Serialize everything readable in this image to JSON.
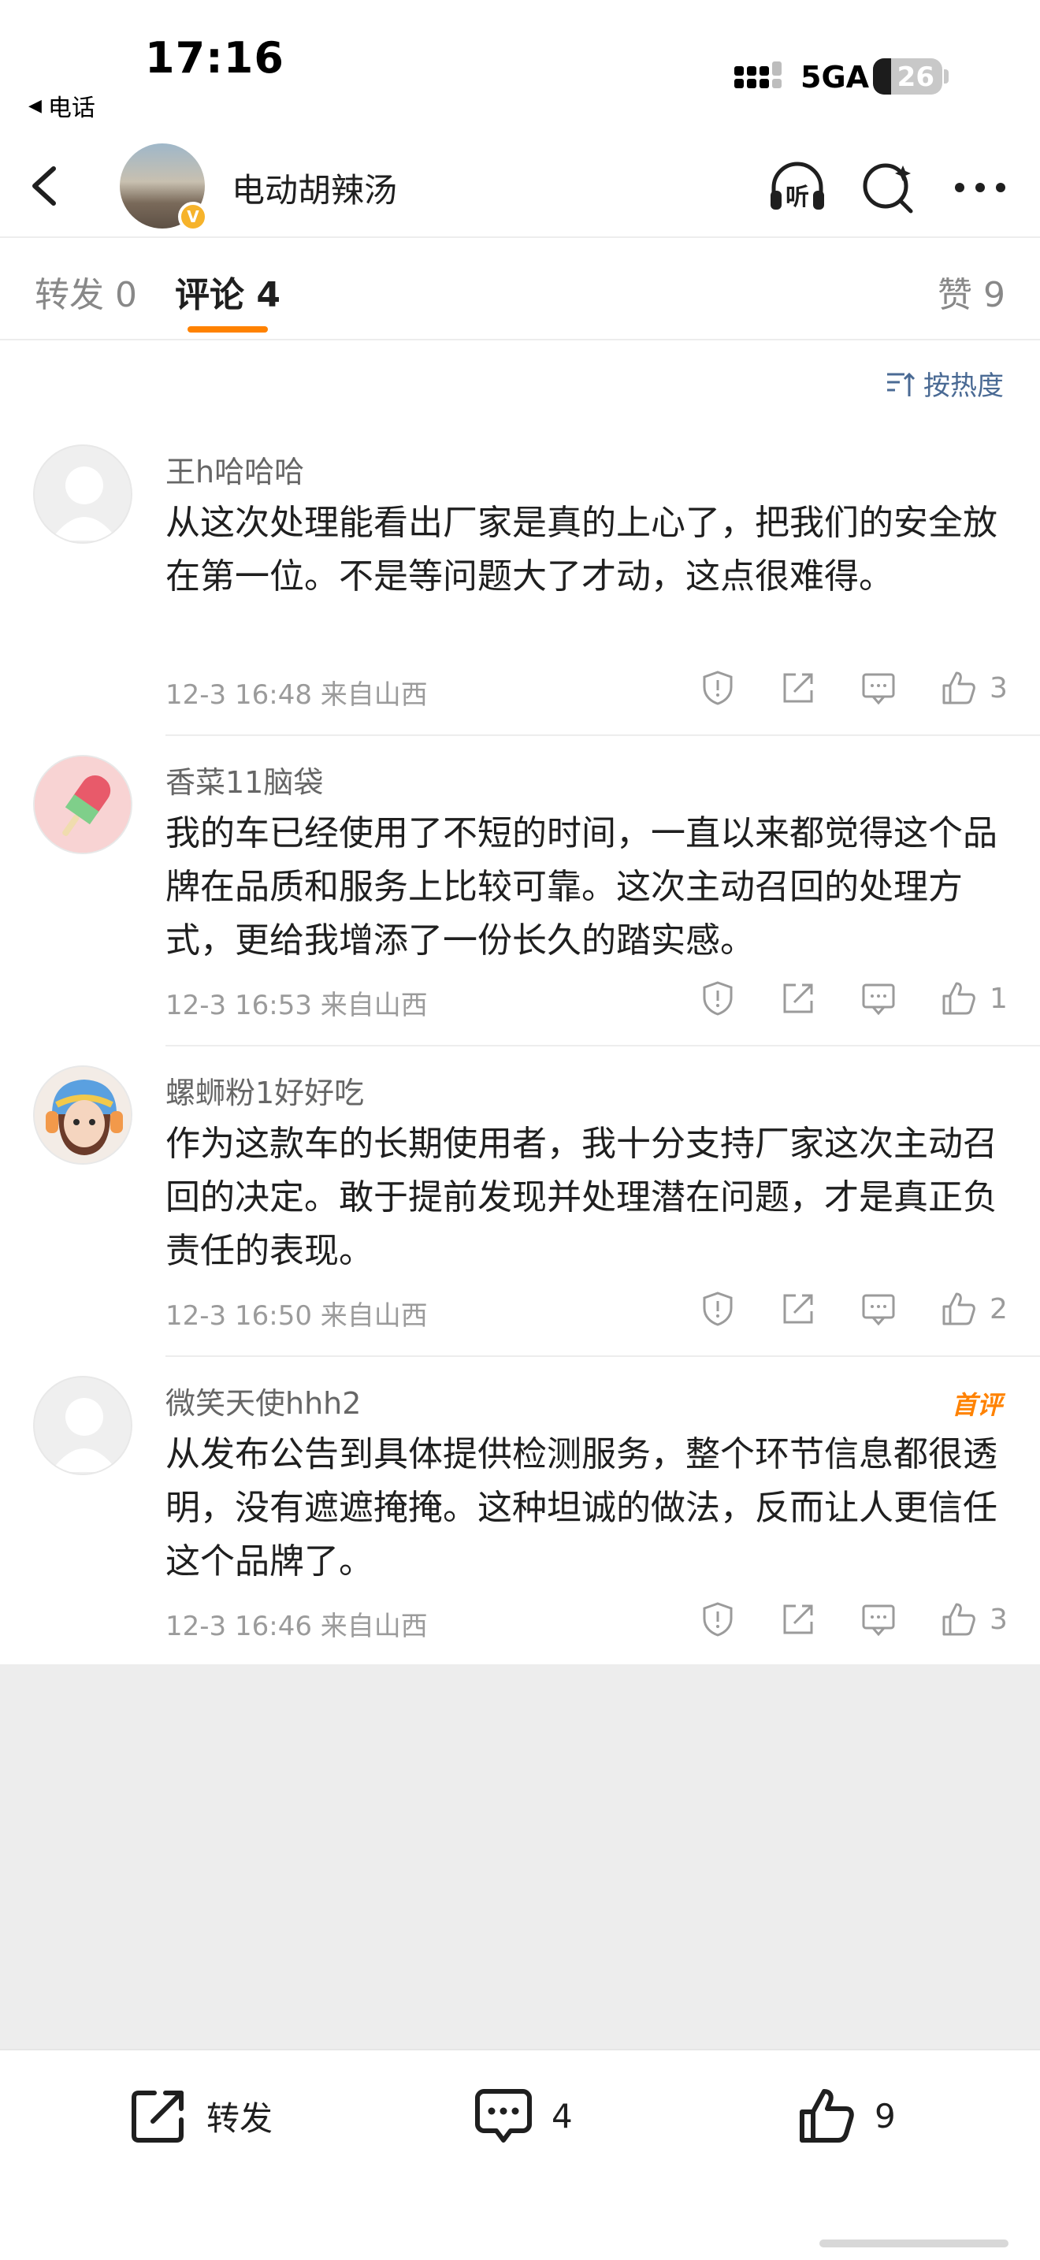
{
  "status_bar": {
    "time": "17:16",
    "back_app_label": "电话",
    "network": "5GA",
    "battery": "26",
    "battery_level": 0.26
  },
  "nav": {
    "title": "电动胡辣汤",
    "verified_badge": "V",
    "listen_label": "听"
  },
  "tabs": [
    {
      "label": "转发 0"
    },
    {
      "label": "评论 4"
    },
    {
      "label": "赞 9"
    }
  ],
  "sort_label": "按热度",
  "comments": [
    {
      "name": "王h哈哈哈",
      "text": "从这次处理能看出厂家是真的上心了，把我们的安全放在第一位。不是等问题大了才动，这点很难得。",
      "meta": "12-3 16:48  来自山西",
      "likes": "3"
    },
    {
      "name": "香菜11脑袋",
      "text": "我的车已经使用了不短的时间，一直以来都觉得这个品牌在品质和服务上比较可靠。这次主动召回的处理方式，更给我增添了一份长久的踏实感。",
      "meta": "12-3 16:53  来自山西",
      "likes": "1"
    },
    {
      "name": "螺蛳粉1好好吃",
      "text": "作为这款车的长期使用者，我十分支持厂家这次主动召回的决定。敢于提前发现并处理潜在问题，才是真正负责任的表现。",
      "meta": "12-3 16:50  来自山西",
      "likes": "2"
    },
    {
      "name": "微笑天使hhh2",
      "text": "从发布公告到具体提供检测服务，整个环节信息都很透明，没有遮遮掩掩。这种坦诚的做法，反而让人更信任这个品牌了。",
      "meta": "12-3 16:46  来自山西",
      "likes": "3",
      "badge": "首评"
    }
  ],
  "bottom_bar": {
    "repost_label": "转发",
    "comment_count": "4",
    "like_count": "9"
  },
  "colors": {
    "accent": "#ff8200",
    "link": "#4a6a94",
    "verified": "#f6b32b"
  }
}
